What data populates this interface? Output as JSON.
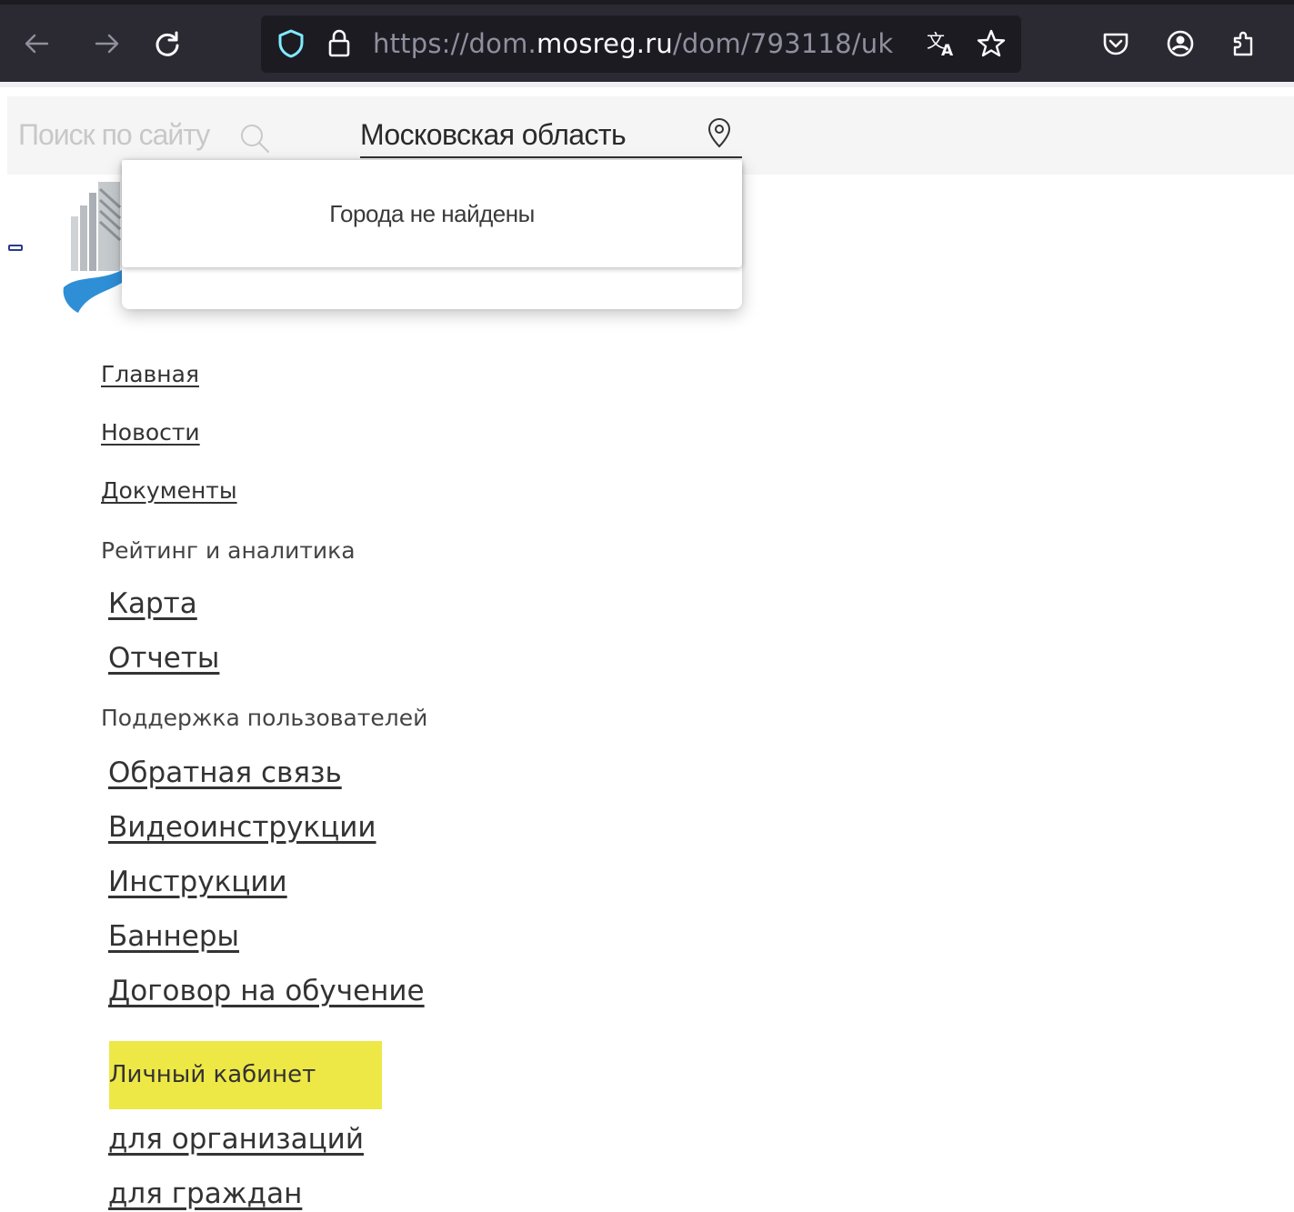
{
  "browser": {
    "url_prefix": "https://dom.",
    "url_host": "mosreg.ru",
    "url_path": "/dom/793118/uk",
    "icons": {
      "back": "arrow-left-icon",
      "forward": "arrow-right-icon",
      "reload": "reload-icon",
      "tracking": "shield-icon",
      "lock": "lock-icon",
      "translate": "translate-icon",
      "bookmark": "star-icon",
      "pocket": "pocket-icon",
      "account": "account-icon",
      "extensions": "extensions-icon"
    }
  },
  "header": {
    "search_placeholder": "Поиск по сайту",
    "region": "Московская область"
  },
  "dropdown": {
    "message": "Города не найдены"
  },
  "menu": {
    "home": "Главная",
    "news": "Новости",
    "documents": "Документы",
    "rating_heading": "Рейтинг и аналитика",
    "map": "Карта",
    "reports": "Отчеты",
    "support_heading": "Поддержка пользователей",
    "feedback": "Обратная связь",
    "video_instructions": "Видеоинструкции",
    "instructions": "Инструкции",
    "banners": "Баннеры",
    "training_contract": "Договор на обучение",
    "cabinet_heading": "Личный кабинет",
    "for_organizations": "для организаций",
    "for_citizens": "для граждан"
  },
  "colors": {
    "chrome_bg": "#2b2a33",
    "urlbar_bg": "#1c1b22",
    "highlight": "#eee847",
    "shield": "#54ffbd"
  }
}
